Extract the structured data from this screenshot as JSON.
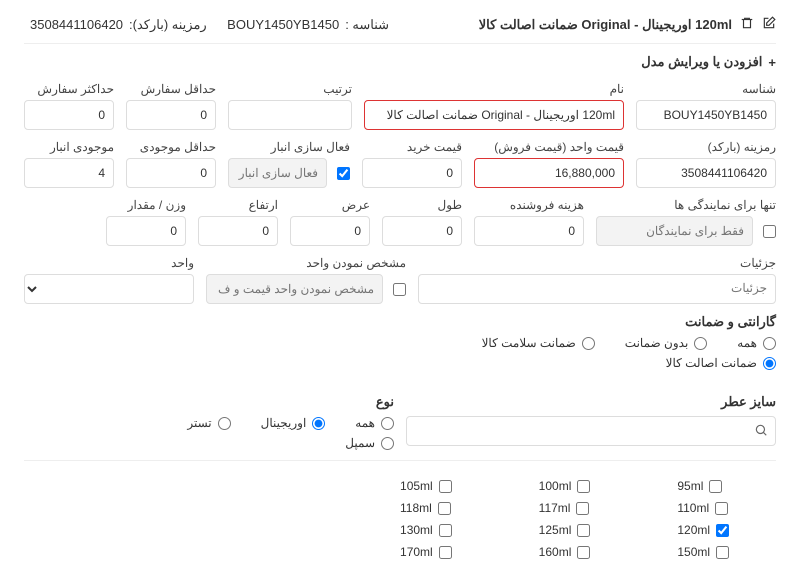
{
  "header": {
    "title_text": "120ml اوریجینال - Original ضمانت اصالت کالا",
    "sku_label": "شناسه :",
    "sku_value": "BOUY1450YB1450",
    "barcode_label": "رمزینه (بارکد):",
    "barcode_value": "3508441106420"
  },
  "section_add_edit": "افزودن یا ویرایش مدل",
  "fields": {
    "sku": {
      "label": "شناسه",
      "value": "BOUY1450YB1450"
    },
    "name": {
      "label": "نام",
      "value": "120ml اوریجینال - Original ضمانت اصالت کالا"
    },
    "sort": {
      "label": "ترتیب",
      "value": ""
    },
    "min_order": {
      "label": "حداقل سفارش",
      "value": "0"
    },
    "max_order": {
      "label": "حداکثر سفارش",
      "value": "0"
    },
    "barcode": {
      "label": "رمزینه (بارکد)",
      "value": "3508441106420"
    },
    "price_sale": {
      "label": "قیمت واحد (قیمت فروش)",
      "value": "16,880,000"
    },
    "price_buy": {
      "label": "قیمت خرید",
      "value": "0"
    },
    "stock_enable": {
      "label": "فعال سازی انبار",
      "placeholder": "فعال سازی انبار برای مدیریت مو"
    },
    "min_stock": {
      "label": "حداقل موجودی",
      "value": "0"
    },
    "stock_qty": {
      "label": "موجودی انبار",
      "value": "4"
    },
    "agent_only": {
      "label": "تنها برای نمایندگی ها",
      "placeholder": "فقط برای نمایندگان"
    },
    "seller_cost": {
      "label": "هزینه فروشنده",
      "value": "0"
    },
    "length": {
      "label": "طول",
      "value": "0"
    },
    "width": {
      "label": "عرض",
      "value": "0"
    },
    "height": {
      "label": "ارتفاع",
      "value": "0"
    },
    "weight": {
      "label": "وزن / مقدار",
      "value": "0"
    },
    "details": {
      "label": "جزئیات",
      "placeholder": "جزئیات"
    },
    "unit_spec": {
      "label": "مشخص نمودن واحد",
      "placeholder": "مشخص نمودن واحد قیمت و ف"
    },
    "unit": {
      "label": "واحد"
    }
  },
  "warranty": {
    "title": "گارانتی و ضمانت",
    "options": [
      "همه",
      "بدون ضمانت",
      "ضمانت سلامت کالا",
      "ضمانت اصالت کالا"
    ]
  },
  "perfume_size": {
    "title": "سایز عطر"
  },
  "type": {
    "title": "نوع",
    "options": [
      "همه",
      "اوریجینال",
      "تستر",
      "سمپل"
    ]
  },
  "sizes": {
    "row1": [
      "95ml",
      "100ml",
      "105ml"
    ],
    "row2": [
      "110ml",
      "117ml",
      "118ml"
    ],
    "row3": [
      "120ml",
      "125ml",
      "130ml"
    ],
    "row4": [
      "150ml",
      "160ml",
      "170ml"
    ]
  },
  "plus": "+"
}
